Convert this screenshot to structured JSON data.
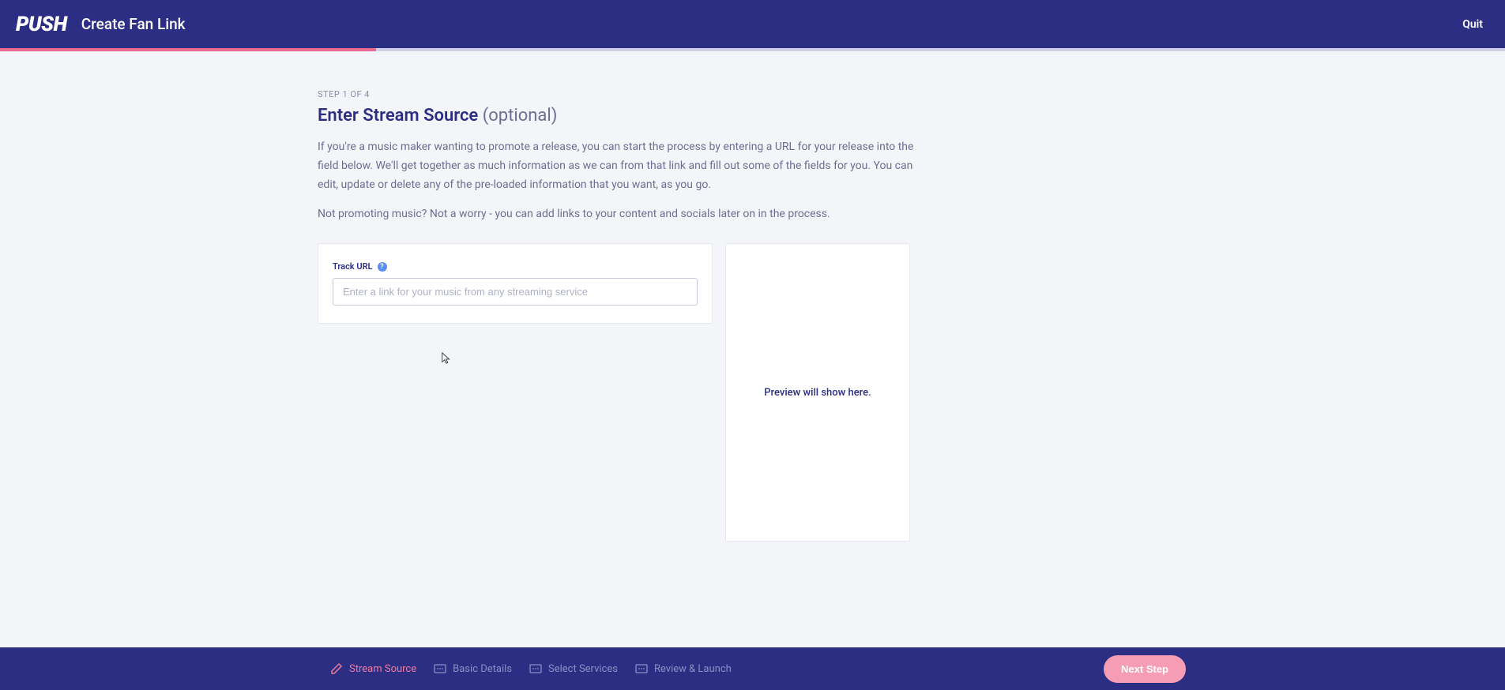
{
  "header": {
    "logo": "PUSH",
    "title": "Create Fan Link",
    "quit": "Quit"
  },
  "page": {
    "step_label": "STEP 1 OF 4",
    "title_main": "Enter Stream Source",
    "title_optional": "(optional)",
    "description1": "If you're a music maker wanting to promote a release, you can start the process by entering a URL for your release into the field below. We'll get together as much information as we can from that link and fill out some of the fields for you. You can edit, update or delete any of the pre-loaded information that you want, as you go.",
    "description2": "Not promoting music? Not a worry - you can add links to your content and socials later on in the process."
  },
  "form": {
    "track_url_label": "Track URL",
    "track_url_placeholder": "Enter a link for your music from any streaming service"
  },
  "preview": {
    "text": "Preview will show here."
  },
  "footer": {
    "steps": [
      {
        "label": "Stream Source",
        "active": true
      },
      {
        "label": "Basic Details",
        "active": false
      },
      {
        "label": "Select Services",
        "active": false
      },
      {
        "label": "Review & Launch",
        "active": false
      }
    ],
    "next_button": "Next Step"
  }
}
